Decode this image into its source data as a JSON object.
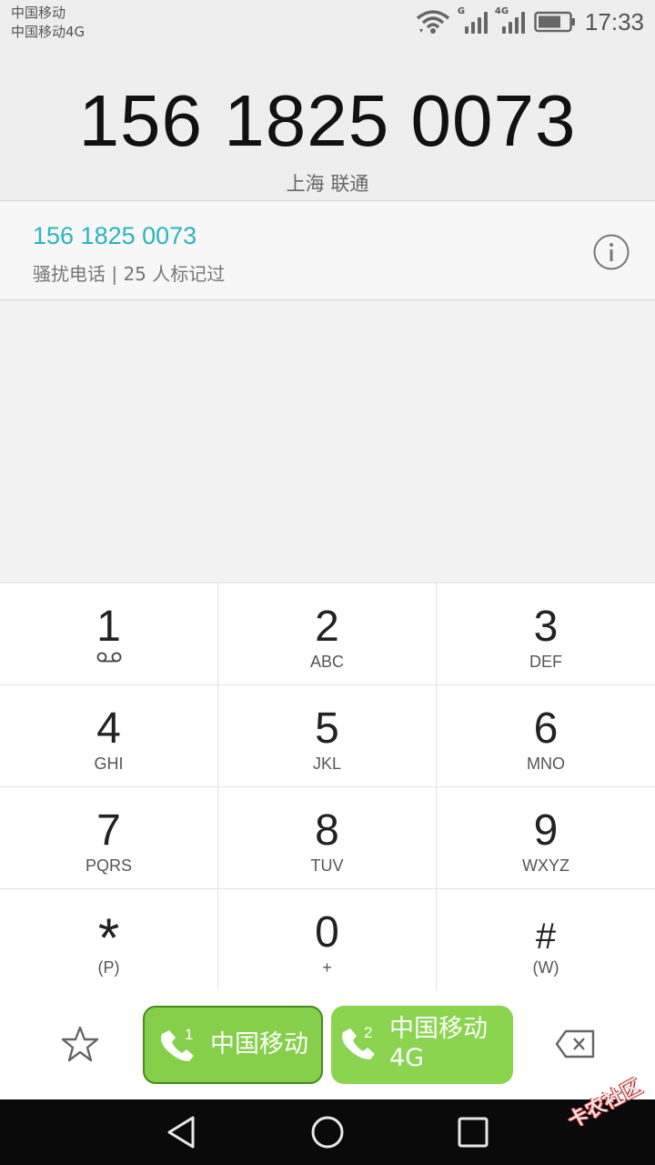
{
  "status_bar": {
    "carrier_1": "中国移动",
    "carrier_2": "中国移动4G",
    "sim1_network": "G",
    "sim2_network": "4G",
    "time": "17:33",
    "battery_level": 0.75
  },
  "display": {
    "dialed_number": "156 1825 0073",
    "location": "上海 联通"
  },
  "match": {
    "number": "156 1825 0073",
    "tag": "骚扰电话 | 25 人标记过",
    "number_color": "#2bb3c0"
  },
  "keypad": {
    "keys": [
      {
        "digit": "1",
        "letters": ""
      },
      {
        "digit": "2",
        "letters": "ABC"
      },
      {
        "digit": "3",
        "letters": "DEF"
      },
      {
        "digit": "4",
        "letters": "GHI"
      },
      {
        "digit": "5",
        "letters": "JKL"
      },
      {
        "digit": "6",
        "letters": "MNO"
      },
      {
        "digit": "7",
        "letters": "PQRS"
      },
      {
        "digit": "8",
        "letters": "TUV"
      },
      {
        "digit": "9",
        "letters": "WXYZ"
      },
      {
        "digit": "*",
        "letters": "(P)"
      },
      {
        "digit": "0",
        "letters": "+"
      },
      {
        "digit": "#",
        "letters": "(W)"
      }
    ]
  },
  "actions": {
    "call_sim1": {
      "sim": "1",
      "label": "中国移动"
    },
    "call_sim2": {
      "sim": "2",
      "label_line1": "中国移动",
      "label_line2": "4G"
    },
    "accent_color": "#86cf4a"
  },
  "icons": {
    "favorite": "star-icon",
    "delete": "backspace-icon",
    "info": "info-icon",
    "voicemail": "voicemail-icon",
    "nav_back": "back-triangle-icon",
    "nav_home": "home-circle-icon",
    "nav_recents": "recents-square-icon"
  },
  "watermark": "卡农社区"
}
